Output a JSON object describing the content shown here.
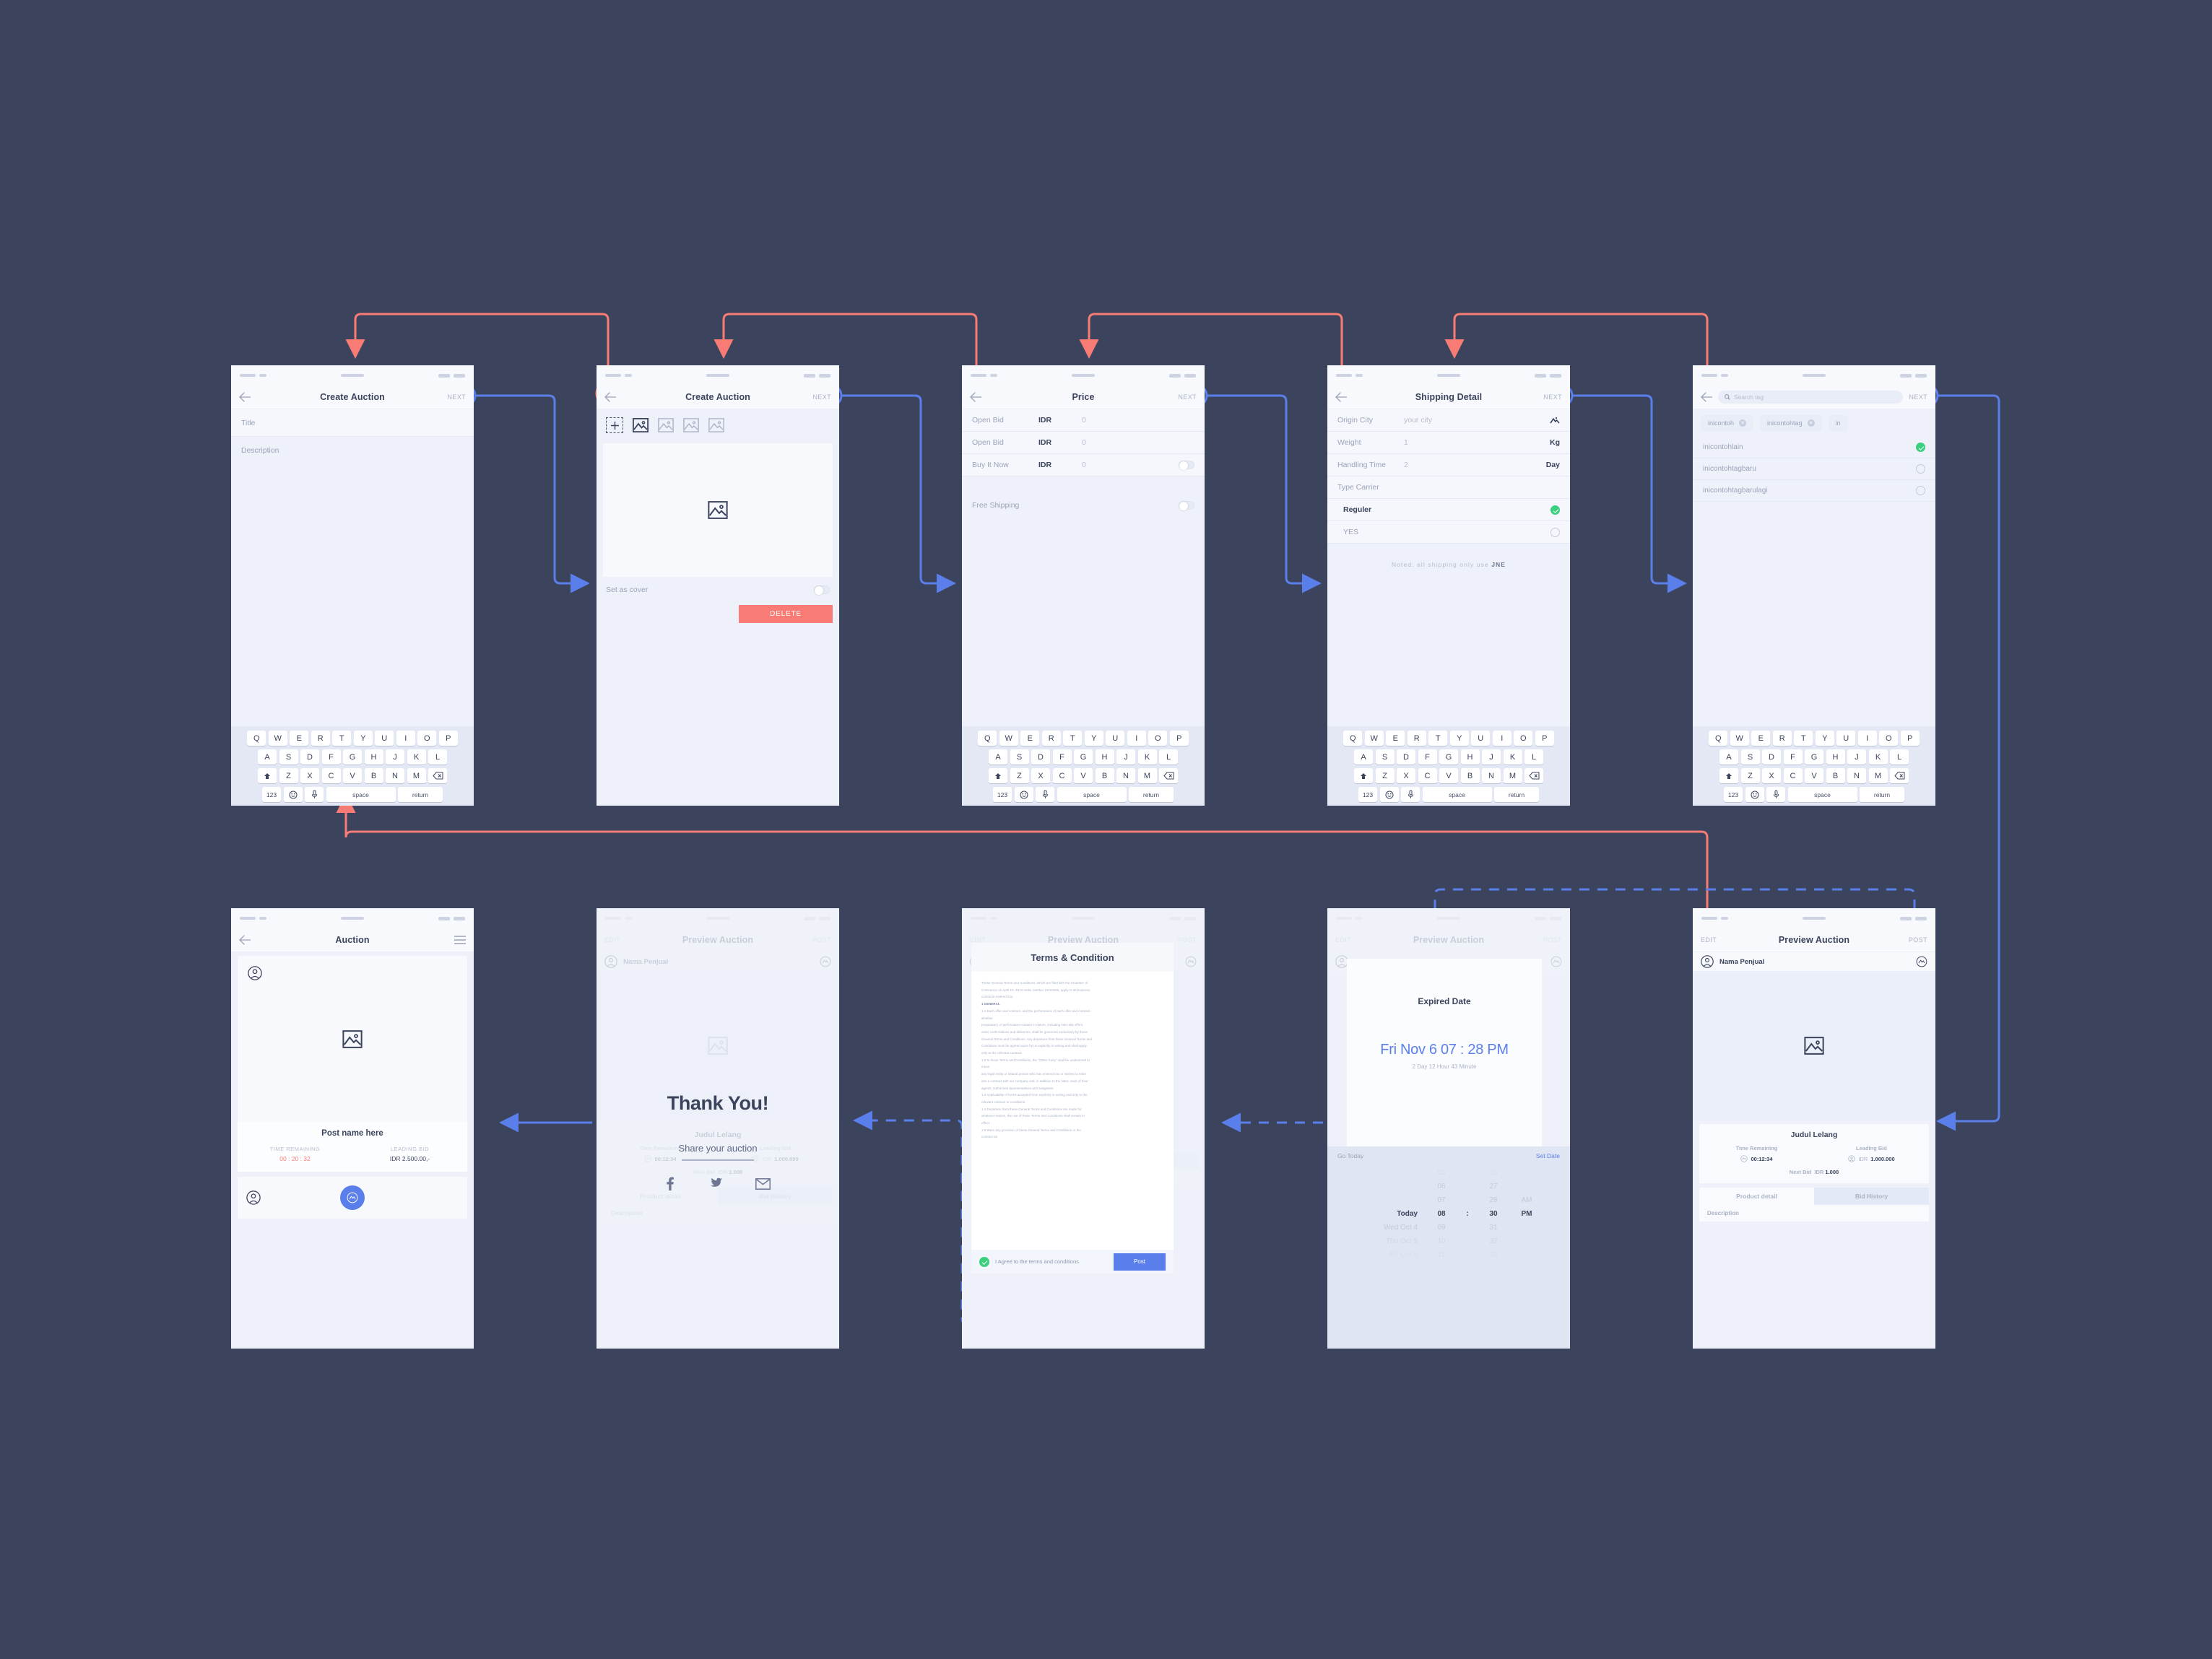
{
  "canvas": {
    "bg": "#3b445c",
    "accent_blue": "#5b7fea",
    "accent_red": "#f87c75",
    "accent_green": "#3ad07f"
  },
  "keyboard": {
    "row1": [
      "Q",
      "W",
      "E",
      "R",
      "T",
      "Y",
      "U",
      "I",
      "O",
      "P"
    ],
    "row2": [
      "A",
      "S",
      "D",
      "F",
      "G",
      "H",
      "J",
      "K",
      "L"
    ],
    "row3": [
      "Z",
      "X",
      "C",
      "V",
      "B",
      "N",
      "M"
    ],
    "num_key": "123",
    "space_key": "space",
    "return_key": "return"
  },
  "screens": {
    "create_auction_1": {
      "title": "Create Auction",
      "next_label": "NEXT",
      "fields": [
        {
          "placeholder": "Title"
        },
        {
          "placeholder": "Description"
        }
      ]
    },
    "create_auction_2": {
      "title": "Create Auction",
      "next_label": "NEXT",
      "set_as_cover_label": "Set as cover",
      "delete_label": "DELETE"
    },
    "price": {
      "title": "Price",
      "next_label": "NEXT",
      "rows": [
        {
          "label": "Open Bid",
          "currency": "IDR",
          "value": "0",
          "toggle": false
        },
        {
          "label": "Open Bid",
          "currency": "IDR",
          "value": "0",
          "toggle": false
        },
        {
          "label": "Buy It Now",
          "currency": "IDR",
          "value": "0",
          "toggle": true
        }
      ],
      "free_shipping_label": "Free Shipping"
    },
    "shipping": {
      "title": "Shipping Detail",
      "next_label": "NEXT",
      "rows": [
        {
          "label": "Origin City",
          "value": "your city",
          "unit": ""
        },
        {
          "label": "Weight",
          "value": "1",
          "unit": "Kg"
        },
        {
          "label": "Handling Time",
          "value": "2",
          "unit": "Day"
        }
      ],
      "type_carrier_label": "Type Carrier",
      "carriers": [
        {
          "label": "Reguler",
          "selected": true
        },
        {
          "label": "YES",
          "selected": false
        }
      ],
      "note": "Noted: all shipping only use ",
      "note_bold": "JNE"
    },
    "tags": {
      "search_placeholder": "Search tag",
      "next_label": "NEXT",
      "chips": [
        "inicontoh",
        "inicontohtag",
        "in"
      ],
      "options": [
        {
          "label": "inicontohlain",
          "selected": true
        },
        {
          "label": "inicontohtagbaru",
          "selected": false
        },
        {
          "label": "inicontohtagbarulagi",
          "selected": false
        }
      ]
    },
    "auction": {
      "title": "Auction",
      "post_name": "Post name here",
      "time_remaining_cap": "TIME REMAINING",
      "time_remaining_val": "00 : 20 : 32",
      "leading_bid_cap": "LEADING BID",
      "leading_bid_val": "IDR 2.500.00,-"
    },
    "thank_you": {
      "heading": "Thank You!",
      "share_title": "Share your auction",
      "social": [
        "facebook-icon",
        "twitter-icon",
        "email-icon"
      ]
    },
    "preview_auction": {
      "title": "Preview Auction",
      "edit_label": "EDIT",
      "post_label": "POST",
      "seller_name": "Nama Penjual",
      "item_title": "Judul Lelang",
      "time_remaining_cap": "Time Remaining",
      "time_remaining_val": "00:12:34",
      "leading_bid_cap": "Leading Bid",
      "leading_bid_currency": "IDR",
      "leading_bid_val": "1.000.000",
      "next_bid_cap": "Next Bid",
      "next_bid_currency": "IDR",
      "next_bid_val": "1.000",
      "tabs": [
        {
          "label": "Product detail",
          "active": false
        },
        {
          "label": "Bid History",
          "active": true
        }
      ],
      "description_label": "Description"
    },
    "terms": {
      "title": "Terms & Condition",
      "paragraphs": [
        {
          "text": "These General Terms and Conditions, which are filed with the Chamber of",
          "bold": false
        },
        {
          "text": "Commerce on April 10, 2014 under number 24233266, apply to all business",
          "bold": false
        },
        {
          "text": "contracts entered into.",
          "bold": false
        },
        {
          "text": "1 GENERAL",
          "bold": true
        },
        {
          "text": "1.1 Each offer and contract, and the performance of each offer and contract,",
          "bold": false
        },
        {
          "text": "whether",
          "bold": false
        },
        {
          "text": "preparatory or performance-related in nature, including inter alia offers,",
          "bold": false
        },
        {
          "text": "order confirmations and deliveries, shall be governed exclusively by these",
          "bold": false
        },
        {
          "text": "General Terms and Conditions. Any departure from these General Terms and",
          "bold": false
        },
        {
          "text": "Conditions must be agreed upon by us explicitly in writing and shall apply",
          "bold": false
        },
        {
          "text": "only to the relevant contract.",
          "bold": false
        },
        {
          "text": "1.2 In these Terms and Conditions, the \"Other Party\" shall be understood to",
          "bold": false
        },
        {
          "text": "mean",
          "bold": false
        },
        {
          "text": "any legal entity or natural person who has entered into or wishes to enter",
          "bold": false
        },
        {
          "text": "into a contract with our company and, in addition to the latter, each of their",
          "bold": false
        },
        {
          "text": "agents, authorised representatives and assignees.",
          "bold": false
        },
        {
          "text": "1.3 Applicability of terms accepted from explicitly in writing and only to the",
          "bold": false
        },
        {
          "text": "relevant contract or conditions.",
          "bold": false
        },
        {
          "text": "1.4 Departure from these General Terms and Conditions are made for",
          "bold": false
        },
        {
          "text": "whatever reason, the use of these Terms and Conditions shall remain in",
          "bold": false
        },
        {
          "text": "effect.",
          "bold": false
        },
        {
          "text": "1.5 Were any provision of these General Terms and Conditions or the",
          "bold": false
        },
        {
          "text": "contract be",
          "bold": false
        }
      ],
      "agree_label": "I Agree to the terms and conditions",
      "post_button": "Post"
    },
    "expired": {
      "title": "Expired Date",
      "date": "Fri Nov 6  07 : 28 PM",
      "duration": "2 Day 12 Hour 43 Minute",
      "go_today_label": "Go Today",
      "set_date_label": "Set Date",
      "picker": {
        "days": [
          "Wed Oct 4",
          "Thu Oct 5",
          "Fri Oct 6"
        ],
        "day_selected": "Today",
        "hours": [
          "05",
          "06",
          "07",
          "08",
          "09",
          "10",
          "11"
        ],
        "hour_selected": "08",
        "minutes": [
          "26",
          "27",
          "28",
          "30",
          "31",
          "32",
          "33"
        ],
        "minute_selected": "30",
        "separator": ":",
        "meridiem": [
          "AM",
          "PM"
        ],
        "meridiem_selected": "PM"
      }
    }
  }
}
